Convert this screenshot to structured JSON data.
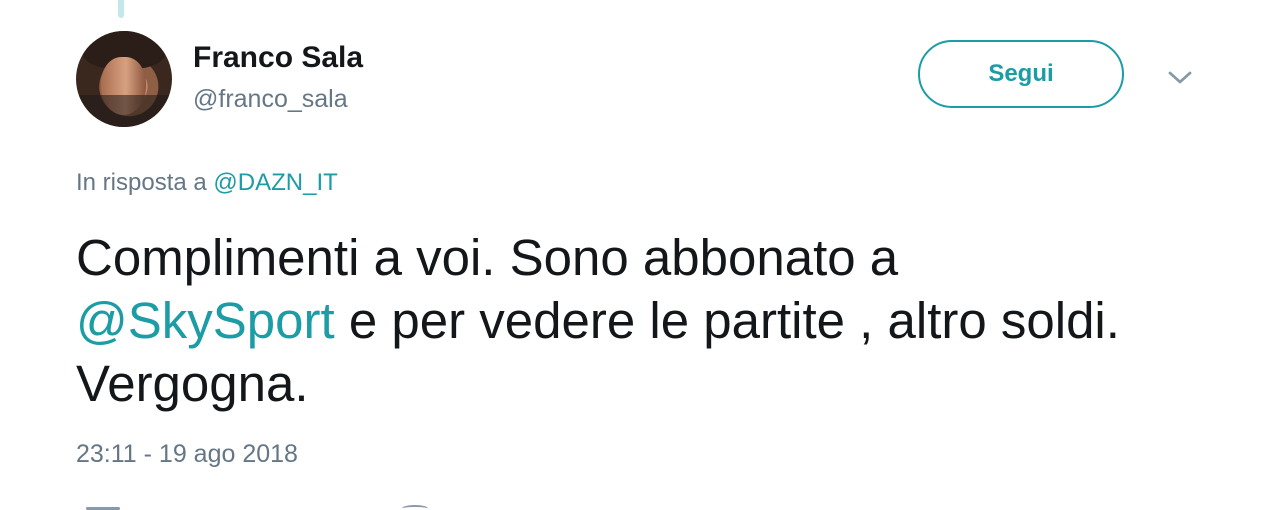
{
  "author": {
    "name": "Franco Sala",
    "handle": "@franco_sala",
    "avatar_icon": "user-avatar"
  },
  "header": {
    "follow_label": "Segui",
    "menu_icon": "chevron-down-icon"
  },
  "reply": {
    "prefix": "In risposta a",
    "mention": "@DAZN_IT"
  },
  "tweet": {
    "line1": "Complimenti a voi. Sono abbonato a",
    "line2_mention": "@SkySport",
    "line2_rest": " e per vedere le partite , altro soldi.",
    "line3": "Vergogna."
  },
  "timestamp": "23:11 - 19 ago 2018",
  "colors": {
    "accent": "#1c9ca5",
    "secondary_text": "#657786",
    "primary_text": "#14171a",
    "thread_line": "#c4e7ea"
  }
}
